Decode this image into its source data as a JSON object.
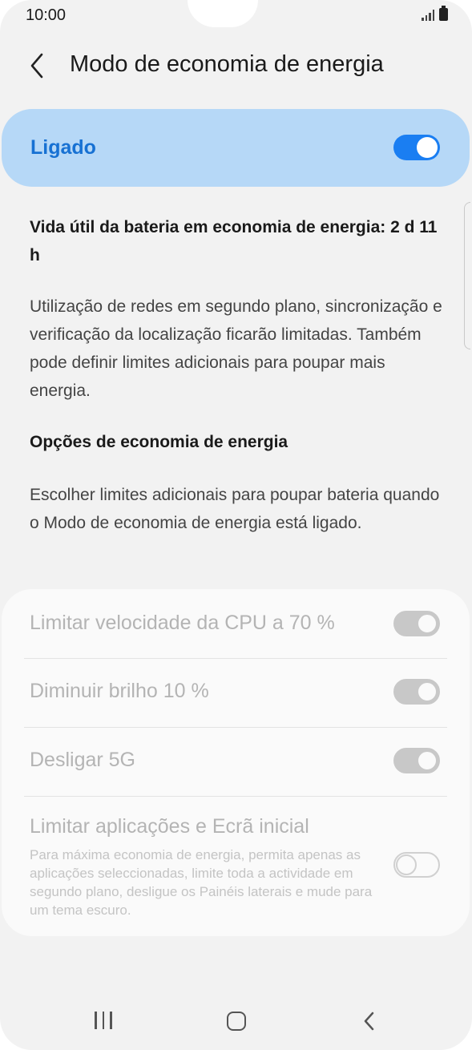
{
  "status_bar": {
    "time": "10:00"
  },
  "header": {
    "title": "Modo de economia de energia"
  },
  "master": {
    "label": "Ligado",
    "enabled": true,
    "accent_color": "#1a7ef2"
  },
  "info": {
    "battery_life": "Vida útil da bateria em economia de energia: 2 d 11 h",
    "description": "Utilização de redes em segundo plano, sincronização e verificação da localização ficarão limitadas. Também pode definir limites adicionais para poupar mais energia."
  },
  "options_section": {
    "title": "Opções de economia de energia",
    "description": "Escolher limites adicionais para poupar bateria quando o Modo de economia de energia está ligado."
  },
  "options": [
    {
      "label": "Limitar velocidade da CPU a 70 %",
      "enabled": true,
      "disabled": true
    },
    {
      "label": "Diminuir brilho 10 %",
      "enabled": true,
      "disabled": true
    },
    {
      "label": "Desligar 5G",
      "enabled": true,
      "disabled": true
    },
    {
      "label": "Limitar aplicações e Ecrã inicial",
      "subtitle": "Para máxima economia de energia, permita apenas as aplicações seleccionadas, limite toda a actividade em segundo plano, desligue os Painéis laterais e mude para um tema escuro.",
      "enabled": false,
      "disabled": true
    }
  ]
}
